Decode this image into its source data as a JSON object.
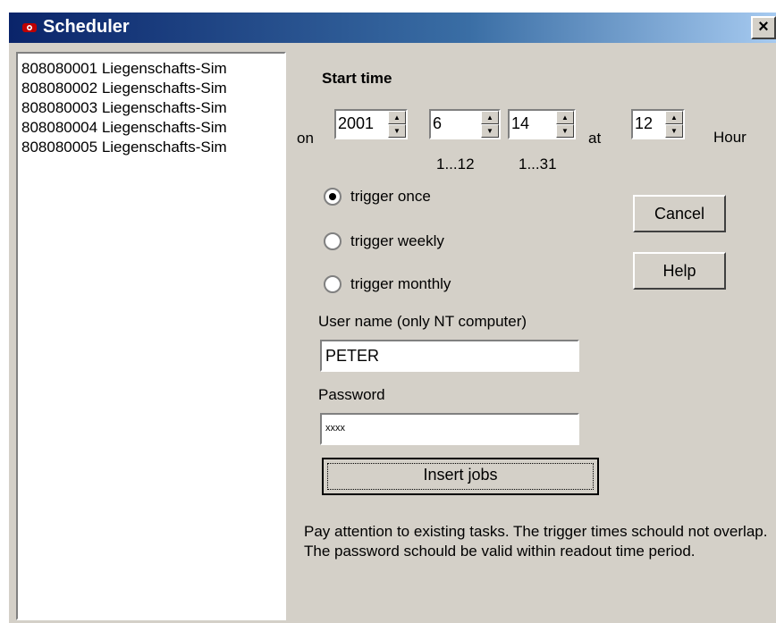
{
  "window": {
    "title": "Scheduler",
    "close_label": "×"
  },
  "jobs": [
    "808080001 Liegenschafts-Sim",
    "808080002 Liegenschafts-Sim",
    "808080003 Liegenschafts-Sim",
    "808080004 Liegenschafts-Sim",
    "808080005 Liegenschafts-Sim"
  ],
  "start": {
    "heading": "Start time",
    "on_label": "on",
    "year": "2001",
    "month": "6",
    "day": "14",
    "at_label": "at",
    "hour": "12",
    "hour_label": "Hour",
    "month_range": "1...12",
    "day_range": "1...31"
  },
  "triggers": {
    "once": "trigger once",
    "weekly": "trigger weekly",
    "monthly": "trigger monthly",
    "selected": "once"
  },
  "buttons": {
    "cancel": "Cancel",
    "help": "Help",
    "insert": "Insert jobs"
  },
  "user": {
    "label": "User name (only NT computer)",
    "value": "PETER"
  },
  "password": {
    "label": "Password",
    "value": "xxxx"
  },
  "note": "Pay attention to existing tasks. The trigger times schould not overlap. The password schould be valid within readout time period."
}
